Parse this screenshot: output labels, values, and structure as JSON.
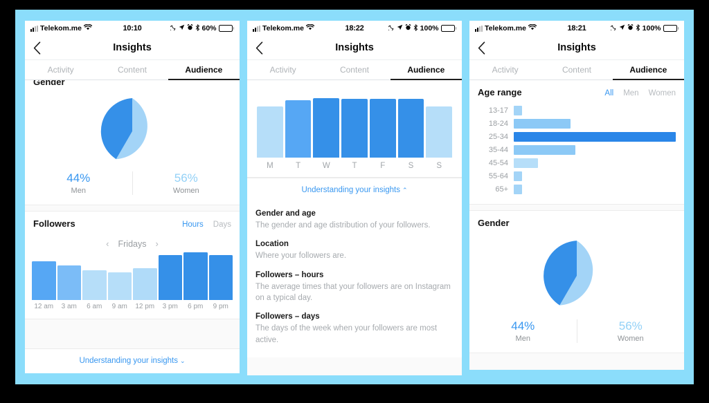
{
  "theme": {
    "page_bg": "#000000",
    "frame_bg": "#8BDDFB",
    "accent_blue": "#3897f0",
    "mid_blue": "#58a9f5",
    "light_blue": "#a8d9f8",
    "pale_blue": "#c2e2fa",
    "dark_blue": "#2a86e8"
  },
  "phones": [
    {
      "id": "phone-hours",
      "status": {
        "carrier": "Telekom.me",
        "time": "10:10",
        "battery_text": "60%",
        "battery_level": 60,
        "icons": [
          "signal-icon",
          "wifi-icon",
          "moon-icon",
          "location-arrow-icon",
          "alarm-icon",
          "bluetooth-icon",
          "battery-icon"
        ]
      },
      "nav": {
        "title": "Insights",
        "back": "back-chevron-icon"
      },
      "tabs": [
        {
          "label": "Activity",
          "active": false
        },
        {
          "label": "Content",
          "active": false
        },
        {
          "label": "Audience",
          "active": true
        }
      ],
      "gender_card": {
        "title": "Gender",
        "men_pct": "44%",
        "men_label": "Men",
        "women_pct": "56%",
        "women_label": "Women"
      },
      "followers_card": {
        "title": "Followers",
        "segments": [
          {
            "label": "Hours",
            "active": true
          },
          {
            "label": "Days",
            "active": false
          }
        ],
        "day_selector": {
          "prev": "‹",
          "value": "Fridays",
          "next": "›"
        }
      },
      "footer_link": {
        "label": "Understanding your insights",
        "chevron": "⌄"
      }
    },
    {
      "id": "phone-days",
      "status": {
        "carrier": "Telekom.me",
        "time": "18:22",
        "battery_text": "100%",
        "battery_level": 100,
        "icons": [
          "signal-icon",
          "wifi-icon",
          "moon-icon",
          "location-arrow-icon",
          "alarm-icon",
          "bluetooth-icon",
          "battery-icon"
        ]
      },
      "nav": {
        "title": "Insights",
        "back": "back-chevron-icon"
      },
      "tabs": [
        {
          "label": "Activity",
          "active": false
        },
        {
          "label": "Content",
          "active": false
        },
        {
          "label": "Audience",
          "active": true
        }
      ],
      "footer_link": {
        "label": "Understanding your insights",
        "chevron": "⌃"
      },
      "glossary": [
        {
          "term": "Gender and age",
          "def": "The gender and age distribution of your followers."
        },
        {
          "term": "Location",
          "def": "Where your followers are."
        },
        {
          "term": "Followers – hours",
          "def": "The average times that your followers are on Instagram on a typical day."
        },
        {
          "term": "Followers – days",
          "def": "The days of the week when your followers are most active."
        }
      ]
    },
    {
      "id": "phone-age",
      "status": {
        "carrier": "Telekom.me",
        "time": "18:21",
        "battery_text": "100%",
        "battery_level": 100,
        "icons": [
          "signal-icon",
          "wifi-icon",
          "moon-icon",
          "location-arrow-icon",
          "alarm-icon",
          "bluetooth-icon",
          "battery-icon"
        ]
      },
      "nav": {
        "title": "Insights",
        "back": "back-chevron-icon"
      },
      "tabs": [
        {
          "label": "Activity",
          "active": false
        },
        {
          "label": "Content",
          "active": false
        },
        {
          "label": "Audience",
          "active": true
        }
      ],
      "age_card": {
        "title": "Age range",
        "segments": [
          {
            "label": "All",
            "active": true
          },
          {
            "label": "Men",
            "active": false
          },
          {
            "label": "Women",
            "active": false
          }
        ]
      },
      "gender_card": {
        "title": "Gender",
        "men_pct": "44%",
        "men_label": "Men",
        "women_pct": "56%",
        "women_label": "Women"
      }
    }
  ],
  "chart_data": [
    {
      "id": "gender-pie-1",
      "type": "pie",
      "title": "Gender",
      "labels": [
        "Men",
        "Women"
      ],
      "values": [
        44,
        56
      ],
      "value_labels": [
        "44%",
        "56%"
      ],
      "colors": [
        "#3590e8",
        "#a3d4f7"
      ],
      "unit": "%",
      "legend": "below"
    },
    {
      "id": "followers-hours",
      "type": "bar",
      "title": "Followers",
      "subtitle": "Fridays",
      "xlabel": "",
      "ylabel": "",
      "categories": [
        "12 am",
        "3 am",
        "6 am",
        "9 am",
        "12 pm",
        "3 pm",
        "6 pm",
        "9 pm"
      ],
      "values": [
        78,
        70,
        60,
        56,
        64,
        90,
        96,
        90
      ],
      "ylim": [
        0,
        100
      ],
      "grid": false,
      "bar_colors": [
        "#56a7f4",
        "#7bbcf7",
        "#b6def9",
        "#b6def9",
        "#b0dbf9",
        "#3590e8",
        "#3590e8",
        "#3590e8"
      ]
    },
    {
      "id": "followers-days",
      "type": "bar",
      "title": "Followers – days",
      "categories": [
        "M",
        "T",
        "W",
        "T",
        "F",
        "S",
        "S"
      ],
      "values": [
        82,
        92,
        96,
        94,
        94,
        94,
        82
      ],
      "ylim": [
        0,
        100
      ],
      "grid": false,
      "bar_colors": [
        "#b6def9",
        "#56a7f4",
        "#3590e8",
        "#3590e8",
        "#3590e8",
        "#3590e8",
        "#b6def9"
      ]
    },
    {
      "id": "age-range",
      "type": "bar",
      "orientation": "horizontal",
      "title": "Age range",
      "categories": [
        "13-17",
        "18-24",
        "25-34",
        "35-44",
        "45-54",
        "55-64",
        "65+"
      ],
      "values": [
        5,
        35,
        100,
        38,
        15,
        5,
        5
      ],
      "ylim": [
        0,
        100
      ],
      "grid": false,
      "bar_colors": [
        "#a3d4f7",
        "#8cc9f6",
        "#2a86e8",
        "#8cc9f6",
        "#b6def9",
        "#a3d4f7",
        "#a3d4f7"
      ]
    },
    {
      "id": "gender-pie-2",
      "type": "pie",
      "title": "Gender",
      "labels": [
        "Men",
        "Women"
      ],
      "values": [
        44,
        56
      ],
      "value_labels": [
        "44%",
        "56%"
      ],
      "colors": [
        "#3590e8",
        "#a3d4f7"
      ],
      "unit": "%",
      "legend": "below"
    }
  ]
}
